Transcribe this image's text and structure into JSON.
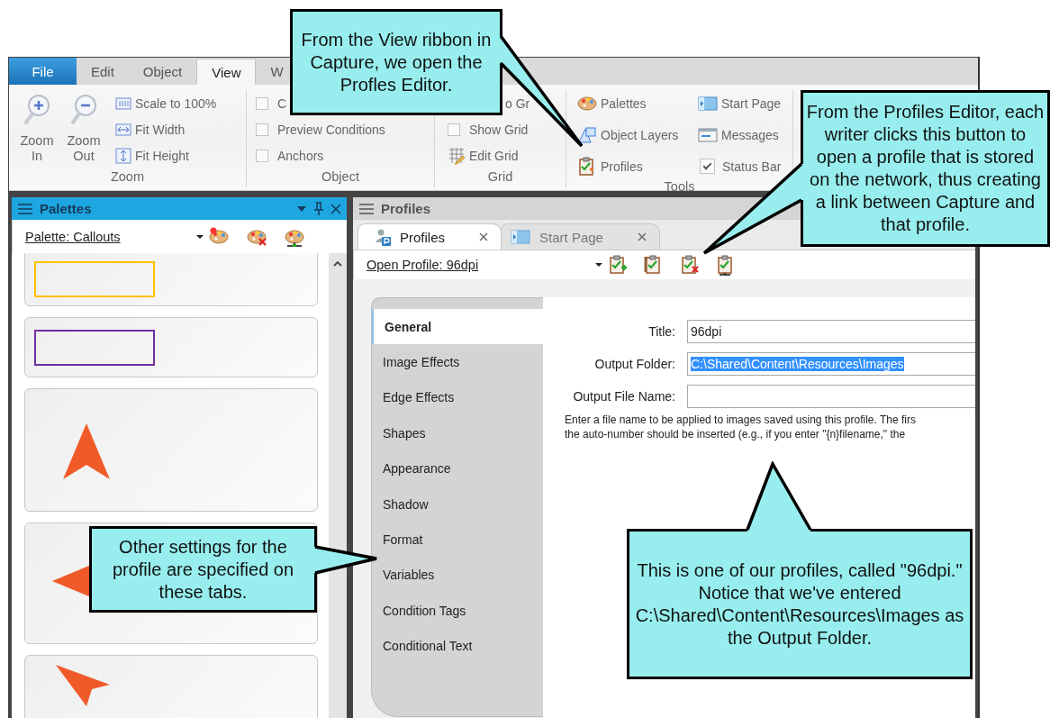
{
  "ribbon_tabs": [
    {
      "label": "File",
      "kind": "file",
      "selected": false
    },
    {
      "label": "Edit",
      "kind": "tab",
      "selected": false
    },
    {
      "label": "Object",
      "kind": "tab",
      "selected": false
    },
    {
      "label": "View",
      "kind": "tab",
      "selected": true
    },
    {
      "label": "W",
      "kind": "tab",
      "selected": false
    }
  ],
  "ribbon": {
    "zoom": {
      "label": "Zoom",
      "large_buttons": [
        "Zoom In",
        "Zoom Out"
      ],
      "buttons": [
        "Scale to 100%",
        "Fit Width",
        "Fit Height"
      ]
    },
    "object": {
      "label": "Object",
      "checkboxes": [
        {
          "label": "C",
          "checked": false
        },
        {
          "label": "Preview Conditions",
          "checked": false
        },
        {
          "label": "Anchors",
          "checked": false
        }
      ]
    },
    "grid": {
      "label": "Grid",
      "items": [
        {
          "kind": "partial",
          "label": "o Gr"
        },
        {
          "kind": "checkbox",
          "label": "Show Grid",
          "checked": false
        },
        {
          "kind": "button",
          "label": "Edit Grid"
        }
      ]
    },
    "tools": {
      "label": "Tools",
      "items": [
        {
          "kind": "button",
          "label": "Palettes"
        },
        {
          "kind": "button",
          "label": "Object Layers"
        },
        {
          "kind": "button",
          "label": "Profiles"
        },
        {
          "kind": "button",
          "label": "Start Page"
        },
        {
          "kind": "button",
          "label": "Messages"
        },
        {
          "kind": "checkbox",
          "label": "Status Bar",
          "checked": true
        }
      ]
    }
  },
  "palettes_panel": {
    "title": "Palettes",
    "dropdown": "Palette: Callouts",
    "cards": [
      {
        "kind": "rectangle",
        "color": "#ffc000"
      },
      {
        "kind": "rectangle",
        "color": "#7030a0"
      },
      {
        "kind": "pointer-up",
        "color": "#f05a28"
      },
      {
        "kind": "pointer-left",
        "color": "#f05a28"
      },
      {
        "kind": "pointer-up-left",
        "color": "#f05a28"
      }
    ]
  },
  "profiles_panel": {
    "title": "Profiles",
    "tabs": [
      {
        "label": "Profiles",
        "selected": true
      },
      {
        "label": "Start Page",
        "selected": false
      }
    ],
    "dropdown": "Open Profile: 96dpi",
    "side_tabs": [
      {
        "label": "General",
        "selected": true
      },
      {
        "label": "Image Effects",
        "selected": false
      },
      {
        "label": "Edge Effects",
        "selected": false
      },
      {
        "label": "Shapes",
        "selected": false
      },
      {
        "label": "Appearance",
        "selected": false
      },
      {
        "label": "Shadow",
        "selected": false
      },
      {
        "label": "Format",
        "selected": false
      },
      {
        "label": "Variables",
        "selected": false
      },
      {
        "label": "Condition Tags",
        "selected": false
      },
      {
        "label": "Conditional Text",
        "selected": false
      }
    ],
    "fields": [
      {
        "label": "Title:",
        "value": "96dpi",
        "highlighted": false
      },
      {
        "label": "Output Folder:",
        "value": "C:\\Shared\\Content\\Resources\\Images",
        "highlighted": true
      },
      {
        "label": "Output File Name:"
      }
    ],
    "help_lines": [
      "Enter a file name to be applied to images saved using this profile. The firs",
      "the auto-number should be inserted (e.g., if you enter \"{n}filename,\" the"
    ]
  },
  "callouts": [
    {
      "text": "From the View ribbon in Capture, we open the Profles Editor."
    },
    {
      "text": "From the Profiles Editor, each writer clicks this button to open a profile that is stored on the network, thus creating a link between Capture and that profile."
    },
    {
      "text": "Other settings for the profile are specified on these tabs."
    },
    {
      "text": "This is one of our profiles, called \"96dpi.\" Notice that we've entered C:\\Shared\\Content\\Resources\\Images as the Output Folder."
    }
  ]
}
